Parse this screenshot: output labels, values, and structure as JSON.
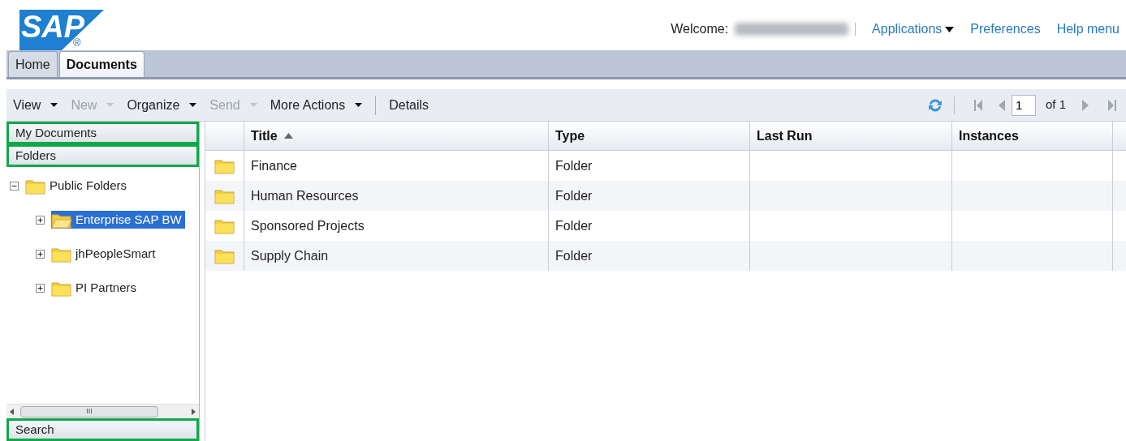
{
  "header": {
    "logo": "SAP",
    "logo_mark": "®",
    "welcome_label": "Welcome:",
    "links": [
      {
        "label": "Applications",
        "dropdown": true
      },
      {
        "label": "Preferences",
        "dropdown": false
      },
      {
        "label": "Help menu",
        "dropdown": false
      }
    ]
  },
  "tabs": [
    {
      "label": "Home",
      "selected": false
    },
    {
      "label": "Documents",
      "selected": true
    }
  ],
  "toolbar": {
    "menus": [
      {
        "label": "View",
        "disabled": false,
        "dropdown": true
      },
      {
        "label": "New",
        "disabled": true,
        "dropdown": true
      },
      {
        "label": "Organize",
        "disabled": false,
        "dropdown": true
      },
      {
        "label": "Send",
        "disabled": true,
        "dropdown": true
      },
      {
        "label": "More Actions",
        "disabled": false,
        "dropdown": true
      },
      {
        "label": "Details",
        "disabled": false,
        "dropdown": false
      }
    ],
    "pager": {
      "page": "1",
      "of": "of 1"
    }
  },
  "sidebar": {
    "panels": [
      {
        "label": "My Documents",
        "highlighted": true
      },
      {
        "label": "Folders",
        "highlighted": true
      }
    ],
    "tree": [
      {
        "label": "Public Folders",
        "expanded": true,
        "selected": false,
        "children": [
          {
            "label": "Enterprise SAP BW",
            "expanded": false,
            "selected": true
          },
          {
            "label": "jhPeopleSmart",
            "expanded": false,
            "selected": false
          },
          {
            "label": "PI Partners",
            "expanded": false,
            "selected": false
          }
        ]
      }
    ],
    "scrollbar_grip": "III",
    "bottom_panel": {
      "label": "Search",
      "highlighted": true
    }
  },
  "table": {
    "columns": [
      {
        "label": "Title",
        "sorted": true
      },
      {
        "label": "Type",
        "sorted": false
      },
      {
        "label": "Last Run",
        "sorted": false
      },
      {
        "label": "Instances",
        "sorted": false
      }
    ],
    "rows": [
      {
        "title": "Finance",
        "type": "Folder"
      },
      {
        "title": "Human Resources",
        "type": "Folder"
      },
      {
        "title": "Sponsored Projects",
        "type": "Folder"
      },
      {
        "title": "Supply Chain",
        "type": "Folder"
      }
    ]
  }
}
